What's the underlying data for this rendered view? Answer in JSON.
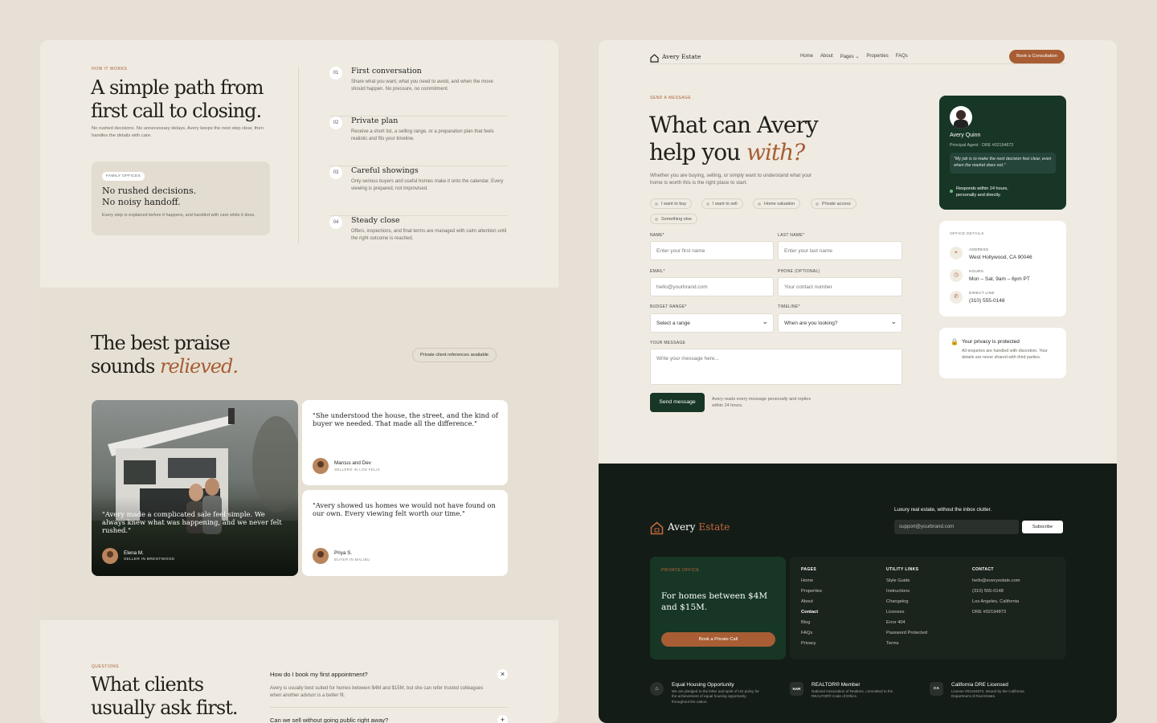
{
  "how": {
    "eyebrow": "HOW IT WORKS",
    "title_line1": "A simple path from",
    "title_line2": "first call to closing.",
    "desc": "No rushed decisions. No unnecessary delays. Avery keeps the next step clear, then handles the details with care.",
    "card": {
      "tag": "FAMILY OFFICES",
      "line1": "No rushed decisions.",
      "line2": "No noisy handoff.",
      "desc": "Every step is explained before it happens, and handled with care while it does."
    },
    "steps": [
      {
        "num": "01",
        "title": "First conversation",
        "desc": "Share what you want, what you need to avoid, and when the move should happen. No pressure, no commitment."
      },
      {
        "num": "02",
        "title": "Private plan",
        "desc": "Receive a short list, a selling range, or a preparation plan that feels realistic and fits your timeline."
      },
      {
        "num": "03",
        "title": "Careful showings",
        "desc": "Only serious buyers and useful homes make it onto the calendar. Every viewing is prepared, not improvised."
      },
      {
        "num": "04",
        "title": "Steady close",
        "desc": "Offers, inspections, and final terms are managed with calm attention until the right outcome is reached."
      }
    ]
  },
  "praise": {
    "title_line1": "The best praise",
    "title_line2a": "sounds ",
    "title_line2b": "relieved.",
    "badge": "Private client references available",
    "featured": {
      "quote": "\"Avery made a complicated sale feel simple. We always knew what was happening, and we never felt rushed.\"",
      "name": "Elena M.",
      "role": "SELLER IN BRENTWOOD"
    },
    "t1": {
      "quote": "\"She understood the house, the street, and the kind of buyer we needed. That made all the difference.\"",
      "name": "Marcus and Dev",
      "role": "SELLERS IN LOS FELIZ"
    },
    "t2": {
      "quote": "\"Avery showed us homes we would not have found on our own. Every viewing felt worth our time.\"",
      "name": "Priya S.",
      "role": "BUYER IN MALIBU"
    }
  },
  "faq": {
    "eyebrow": "QUESTIONS",
    "title_line1": "What clients",
    "title_line2": "usually ask first.",
    "q1": "How do I book my first appointment?",
    "a1": "Avery is usually best suited for homes between $4M and $15M, but she can refer trusted colleagues when another advisor is a better fit.",
    "q2": "Can we sell without going public right away?",
    "close_glyph": "×",
    "open_glyph": "+"
  },
  "nav": {
    "brand": "Avery Estate",
    "links": [
      "Home",
      "About",
      "Pages",
      "Properties",
      "FAQs"
    ],
    "cta": "Book a Consultation"
  },
  "form": {
    "eyebrow": "SEND A MESSAGE",
    "title_line1": "What can Avery",
    "title_line2a": "help you ",
    "title_line2b": "with?",
    "desc": "Whether you are buying, selling, or simply want to understand what your home is worth this is the right place to start.",
    "chips": [
      "I want to buy",
      "I want to sell",
      "Home valuation",
      "Private access",
      "Something else"
    ],
    "name_label": "NAME*",
    "name_ph": "Enter your first name",
    "last_label": "LAST NAME*",
    "last_ph": "Enter your last name",
    "email_label": "EMAIL*",
    "email_ph": "hello@yourbrand.com",
    "phone_label": "PHONE (OPTIONAL)",
    "phone_ph": "Your contact number",
    "budget_label": "BUDGET RANGE*",
    "budget_val": "Select a range",
    "timeline_label": "TIMELINE*",
    "timeline_val": "When are you looking?",
    "msg_label": "YOUR MESSAGE",
    "msg_ph": "Write your message here...",
    "submit": "Send message",
    "note": "Avery reads every message personally and replies within 24 hours."
  },
  "agent": {
    "name": "Avery Quinn",
    "title": "Principal Agent · DRE #02194873",
    "quote": "\"My job is to make the next decision feel clear, even when the market does not.\"",
    "response": "Responds within 24 hours, personally and directly."
  },
  "office": {
    "heading": "OFFICE DETAILS",
    "address_label": "ADDRESS",
    "address": "West Hollywood, CA 90046",
    "hours_label": "HOURS",
    "hours": "Mon – Sat, 9am – 6pm PT",
    "line_label": "DIRECT LINE",
    "line": "(310) 555-0148"
  },
  "privacy": {
    "title": "Your privacy is protected",
    "desc": "All enquiries are handled with discretion. Your details are never shared with third parties."
  },
  "footer": {
    "brand_a": "Avery ",
    "brand_b": "Estate",
    "newsletter": "Luxury real estate, without the inbox clutter.",
    "email_ph": "support@yourbrand.com",
    "subscribe": "Subscribe",
    "office_eyebrow": "PRIVATE OFFICE",
    "office_title": "For homes between $4M and $15M.",
    "office_cta": "Book a Private Call",
    "pages_head": "PAGES",
    "pages": [
      "Home",
      "Properties",
      "About",
      "Contact",
      "Blog",
      "FAQs",
      "Privacy"
    ],
    "util_head": "UTILITY LINKS",
    "utils": [
      "Style Guide",
      "Instructions",
      "Changelog",
      "Licenses",
      "Error 404",
      "Password Protected",
      "Terms"
    ],
    "contact_head": "CONTACT",
    "contacts": [
      "hello@everyestate.com",
      "(310) 555-0148",
      "Los Angeles, California",
      "DRE #02194873"
    ],
    "badges": [
      {
        "mark": "⌂",
        "title": "Equal Housing Opportunity",
        "desc": "We are pledged to the letter and spirit of US policy for the achievement of equal housing opportunity throughout the nation."
      },
      {
        "mark": "NAR",
        "title": "REALTOR® Member",
        "desc": "National Association of Realtors, committed to the REALTOR® Code of Ethics."
      },
      {
        "mark": "CA",
        "title": "California DRE Licensed",
        "desc": "License #02194873. Issued by the California Department of Real Estate."
      }
    ]
  },
  "colors": {
    "accent": "#a85d34",
    "dark_green": "#173626",
    "footer": "#141c17",
    "cream": "#efebe2"
  }
}
